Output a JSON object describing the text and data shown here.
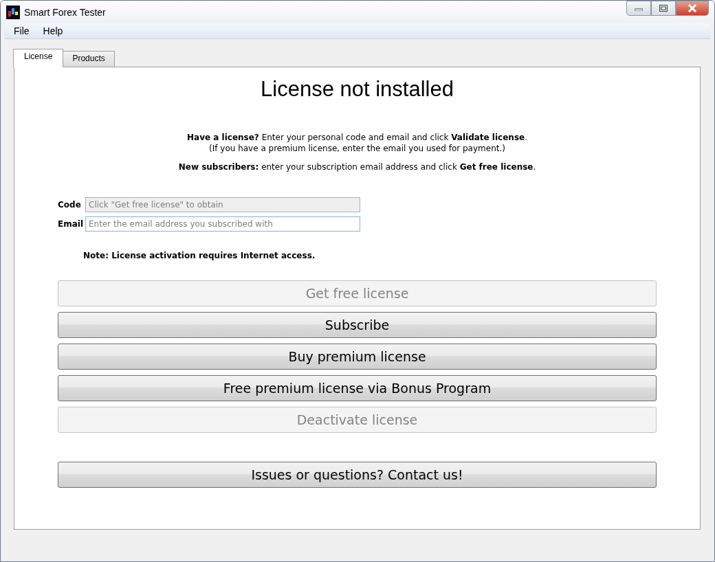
{
  "window": {
    "title": "Smart Forex Tester"
  },
  "menu": [
    "File",
    "Help"
  ],
  "tabs": [
    {
      "label": "License",
      "selected": true
    },
    {
      "label": "Products",
      "selected": false
    }
  ],
  "heading": "License not installed",
  "instructions": [
    "**Have a license?** Enter your personal code and email and click **Validate license**.",
    "(If you have a premium license, enter the email you used for payment.)"
  ],
  "subscriber_note": "**New subscribers:** enter your subscription email address and click **Get free license**.",
  "fields": [
    {
      "label": "Code",
      "placeholder": "Click \"Get free license\" to obtain",
      "disabled": true,
      "focused": false
    },
    {
      "label": "Email",
      "placeholder": "Enter the email address you subscribed with",
      "disabled": false,
      "focused": true
    }
  ],
  "note": "Note: License activation requires Internet access.",
  "buttons": [
    {
      "label": "Get free license",
      "disabled": true
    },
    {
      "label": "Subscribe",
      "disabled": false
    },
    {
      "label": "Buy premium license",
      "disabled": false
    },
    {
      "label": "Free premium license via Bonus Program",
      "disabled": false
    },
    {
      "label": "Deactivate license",
      "disabled": true
    }
  ],
  "contact_button": {
    "label": "Issues or questions? Contact us!",
    "disabled": false
  }
}
